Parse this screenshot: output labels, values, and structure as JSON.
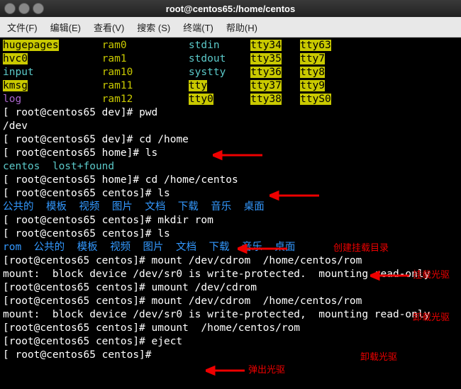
{
  "titlebar": {
    "title": "root@centos65:/home/centos"
  },
  "menu": {
    "file": "文件(F)",
    "edit": "编辑(E)",
    "view": "查看(V)",
    "search": "搜索 (S)",
    "terminal": "终端(T)",
    "help": "帮助(H)"
  },
  "cols": {
    "c1": [
      "hugepages",
      "hvc0",
      "input",
      "kmsg",
      "log"
    ],
    "c2": [
      "ram0",
      "ram1",
      "ram10",
      "ram11",
      "ram12"
    ],
    "c3": [
      "stdin",
      "stdout",
      "systty",
      "tty",
      "tty0"
    ],
    "c4": [
      "tty34",
      "tty35",
      "tty36",
      "tty37",
      "tty38"
    ],
    "c5": [
      "tty63",
      "tty7",
      "tty8",
      "tty9",
      "ttyS0"
    ]
  },
  "lines": {
    "p1": "[ root@centos65 dev]# ",
    "cmd1": "pwd",
    "out1": "/dev",
    "p2": "[ root@centos65 dev]# ",
    "cmd2": "cd /home",
    "p3": "[ root@centos65 home]# ",
    "cmd3": "ls",
    "out3": "centos  lost+found",
    "p4": "[ root@centos65 home]# ",
    "cmd4": "cd /home/centos",
    "p5": "[ root@centos65 centos]# ",
    "cmd5": "ls",
    "out5": [
      "公共的",
      "模板",
      "视频",
      "图片",
      "文档",
      "下载",
      "音乐",
      "桌面"
    ],
    "p6": "[ root@centos65 centos]# ",
    "cmd6": "mkdir rom",
    "p7": "[ root@centos65 centos]# ",
    "cmd7": "ls",
    "out7_a": "rom",
    "out7_b": [
      "公共的",
      "模板",
      "视频",
      "图片",
      "文档",
      "下载",
      "音乐",
      "桌面"
    ],
    "p8": "[root@centos65 centos]# ",
    "cmd8": "mount /dev/cdrom  /home/centos/rom",
    "out8": "mount:  block device /dev/sr0 is write-protected.  mounting read-only",
    "p9": "[root@centos65 centos]# ",
    "cmd9": "umount /dev/cdrom",
    "p10": "[root@centos65 centos]# ",
    "cmd10": "mount /dev/cdrom  /home/centos/rom",
    "out10": "mount:  block device /dev/sr0 is write-protected,  mounting read-only",
    "p11": "[root@centos65 centos]# ",
    "cmd11": "umount  /home/centos/rom",
    "p12": "[root@centos65 centos]# ",
    "cmd12": "eject",
    "p13": "[ root@centos65 centos]# "
  },
  "annotations": {
    "a1": "创建挂载目录",
    "a2": "挂载光驱",
    "a3": "卸载光驱",
    "a4": "卸载光驱",
    "a5": "弹出光驱"
  }
}
